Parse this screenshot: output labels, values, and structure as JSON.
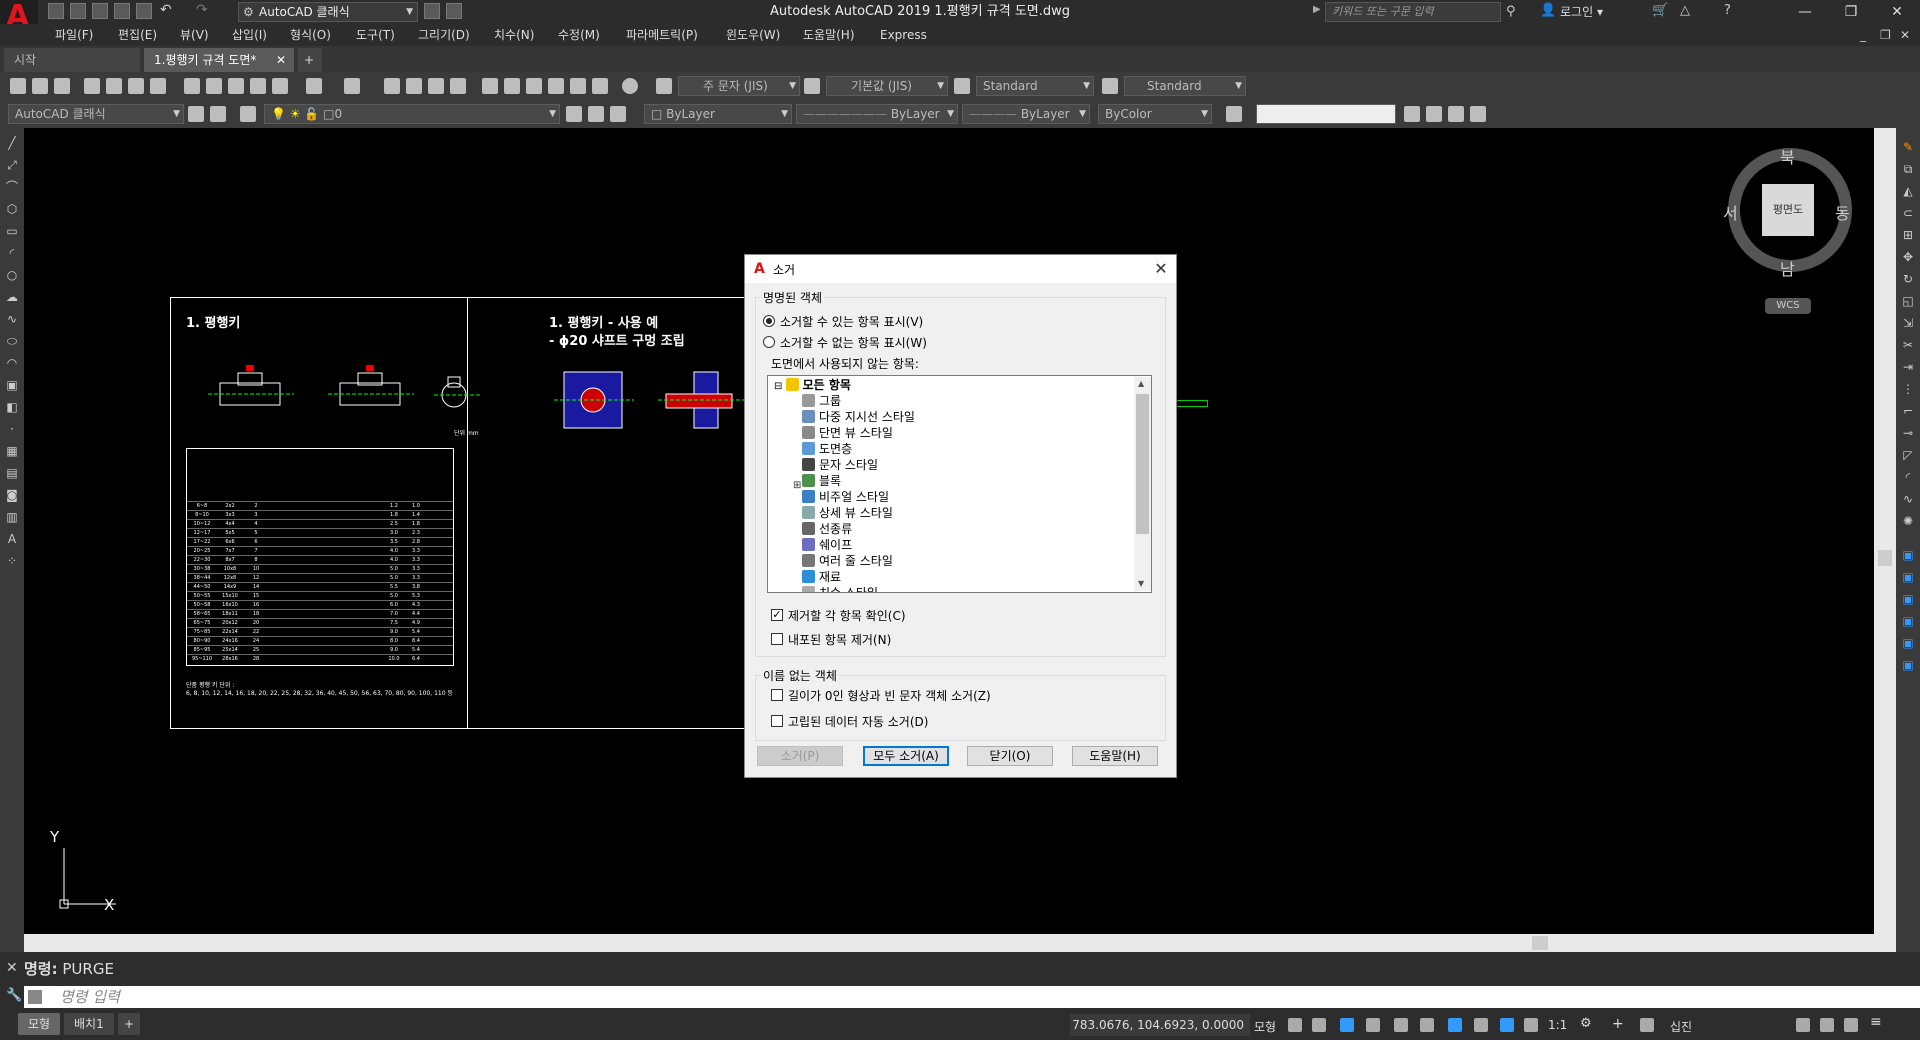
{
  "app": {
    "title": "Autodesk AutoCAD 2019    1.평행키 규격 도면.dwg",
    "workspace": "AutoCAD 클래식",
    "search_placeholder": "키워드 또는 구문 입력",
    "login": "로그인"
  },
  "menu": [
    "파일(F)",
    "편집(E)",
    "뷰(V)",
    "삽입(I)",
    "형식(O)",
    "도구(T)",
    "그리기(D)",
    "치수(N)",
    "수정(M)",
    "파라메트릭(P)",
    "윈도우(W)",
    "도움말(H)",
    "Express"
  ],
  "tabs": [
    {
      "label": "시작"
    },
    {
      "label": "1.평행키 규격 도면*"
    }
  ],
  "toolbar": {
    "text_style": "주 문자 (JIS)",
    "dim_style": "기본값 (JIS)",
    "table_style": "Standard",
    "mleader_style": "Standard",
    "workspace2": "AutoCAD 클래식",
    "layer": "0",
    "color": "ByLayer",
    "linetype": "ByLayer",
    "lineweight": "ByLayer",
    "plotstyle": "ByColor"
  },
  "drawing": {
    "panel1_title": "1. 평행키",
    "panel2_title_line1": "1. 평행키 - 사용 예",
    "panel2_title_line2": "- ϕ20 샤프트 구멍 조립",
    "unit_note": "단위 mm",
    "footnote_line1": "단품 평행 키 단위 :",
    "footnote_line2": "6, 8, 10, 12, 14, 16, 18, 20, 22, 25, 28, 32, 36, 40, 45, 50, 56, 63, 70, 80, 90, 100, 110 등",
    "table_rows": [
      [
        "6~8",
        "2x2",
        "2",
        "1.2",
        "1.0"
      ],
      [
        "8~10",
        "3x3",
        "3",
        "1.8",
        "1.4"
      ],
      [
        "10~12",
        "4x4",
        "4",
        "2.5",
        "1.8"
      ],
      [
        "12~17",
        "5x5",
        "5",
        "3.0",
        "2.3"
      ],
      [
        "17~22",
        "6x6",
        "6",
        "3.5",
        "2.8"
      ],
      [
        "20~25",
        "7x7",
        "7",
        "4.0",
        "3.3"
      ],
      [
        "22~30",
        "8x7",
        "8",
        "4.0",
        "3.3"
      ],
      [
        "30~38",
        "10x8",
        "10",
        "5.0",
        "3.3"
      ],
      [
        "38~44",
        "12x8",
        "12",
        "5.0",
        "3.3"
      ],
      [
        "44~50",
        "14x9",
        "14",
        "5.5",
        "3.8"
      ],
      [
        "50~55",
        "15x10",
        "15",
        "5.0",
        "5.3"
      ],
      [
        "50~58",
        "16x10",
        "16",
        "6.0",
        "4.3"
      ],
      [
        "58~65",
        "18x11",
        "18",
        "7.0",
        "4.4"
      ],
      [
        "65~75",
        "20x12",
        "20",
        "7.5",
        "4.9"
      ],
      [
        "75~85",
        "22x14",
        "22",
        "9.0",
        "5.4"
      ],
      [
        "80~90",
        "24x16",
        "24",
        "8.0",
        "8.4"
      ],
      [
        "85~95",
        "25x14",
        "25",
        "9.0",
        "5.4"
      ],
      [
        "95~110",
        "28x16",
        "28",
        "10.0",
        "6.4"
      ]
    ]
  },
  "viewcube": {
    "north": "북",
    "south": "남",
    "east": "동",
    "west": "서",
    "face": "평면도",
    "wcs": "WCS"
  },
  "axis": {
    "y": "Y",
    "x": "X"
  },
  "dialog": {
    "title": "소거",
    "named_group": "명명된 객체",
    "radio1": "소거할 수 있는 항목 표시(V)",
    "radio2": "소거할 수 없는 항목 표시(W)",
    "tree_label": "도면에서 사용되지 않는 항목:",
    "tree_root": "모든 항목",
    "tree_items": [
      "그룹",
      "다중 지시선 스타일",
      "단면 뷰 스타일",
      "도면층",
      "문자 스타일",
      "블록",
      "비주얼 스타일",
      "상세 뷰 스타일",
      "선종류",
      "쉐이프",
      "여러 줄 스타일",
      "재료",
      "치수 스타일"
    ],
    "chk_confirm": "제거할 각 항목 확인(C)",
    "chk_nested": "내포된 항목 제거(N)",
    "unnamed_group": "이름 없는 객체",
    "chk_zero": "길이가 0인 형상과 빈 문자 객체 소거(Z)",
    "chk_orphan": "고립된 데이터 자동 소거(D)",
    "btn_purge": "소거(P)",
    "btn_purge_all": "모두 소거(A)",
    "btn_close": "닫기(O)",
    "btn_help": "도움말(H)"
  },
  "command": {
    "history_prefix": "명령:",
    "history_cmd": "PURGE",
    "placeholder": "명령 입력"
  },
  "status": {
    "coords": "783.0676, 104.6923, 0.0000",
    "model_label": "모형",
    "tab_model": "모형",
    "tab_layout": "배치1",
    "scale": "1:1",
    "units": "십진"
  },
  "colors": {
    "accent": "#0078d7",
    "autocad_red": "#e0161e"
  }
}
